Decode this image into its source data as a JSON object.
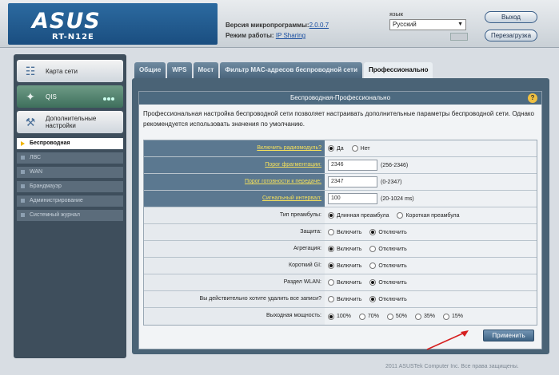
{
  "header": {
    "logo": "ASUS",
    "model": "RT-N12E",
    "firmware_label": "Версия микропрограммы:",
    "firmware_value": "2.0.0.7",
    "mode_label": "Режим работы:",
    "mode_value": "IP Sharing",
    "language_label": "язык",
    "language_value": "Русский",
    "logout_label": "Выход",
    "reboot_label": "Перезагрузка"
  },
  "sidebar": {
    "main_items": [
      {
        "label": "Карта сети",
        "icon": "network-map-icon"
      },
      {
        "label": "QIS",
        "icon": "wand-icon"
      },
      {
        "label": "Дополнительные настройки",
        "icon": "tools-icon"
      }
    ],
    "sub_items": [
      {
        "label": "Беспроводная",
        "active": true
      },
      {
        "label": "ЛВС",
        "active": false
      },
      {
        "label": "WAN",
        "active": false
      },
      {
        "label": "Брандмауэр",
        "active": false
      },
      {
        "label": "Администрирование",
        "active": false
      },
      {
        "label": "Системный журнал",
        "active": false
      }
    ]
  },
  "tabs": [
    "Общие",
    "WPS",
    "Мост",
    "Фильтр MAC-адресов беспроводной сети",
    "Профессионально"
  ],
  "active_tab": "Профессионально",
  "panel": {
    "title": "Беспроводная-Профессионально",
    "description": "Профессиональная настройка беспроводной сети позволяет настраивать дополнительные параметры беспроводной сети. Однако рекомендуется использовать значения по умолчанию.",
    "rows": {
      "radio": {
        "label": "Включить радиомодуль?",
        "yes": "Да",
        "no": "Нет"
      },
      "frag": {
        "label": "Порог фрагментации:",
        "value": "2346",
        "range": "(256-2346)"
      },
      "rts": {
        "label": "Порог готовности к передаче:",
        "value": "2347",
        "range": "(0-2347)"
      },
      "beacon": {
        "label": "Сигнальный интервал:",
        "value": "100",
        "range": "(20-1024 ms)"
      },
      "preamble": {
        "label": "Тип преамбулы:",
        "opt1": "Длинная преамбула",
        "opt2": "Короткая преамбула"
      },
      "protection": {
        "label": "Защита:",
        "on": "Включить",
        "off": "Отключить"
      },
      "aggregation": {
        "label": "Агрегация:",
        "on": "Включить",
        "off": "Отключить"
      },
      "short_gi": {
        "label": "Короткий GI:",
        "on": "Включить",
        "off": "Отключить"
      },
      "wlan_isolation": {
        "label": "Раздел WLAN:",
        "on": "Включить",
        "off": "Отключить"
      },
      "delete_all": {
        "label": "Вы действительно хотите удалить все записи?",
        "on": "Включить",
        "off": "Отключить"
      },
      "tx_power": {
        "label": "Выходная мощность:",
        "options": [
          "100%",
          "70%",
          "50%",
          "35%",
          "15%"
        ]
      }
    },
    "apply_label": "Применить"
  },
  "footer": "2011 ASUSTek Computer Inc. Все права защищены."
}
